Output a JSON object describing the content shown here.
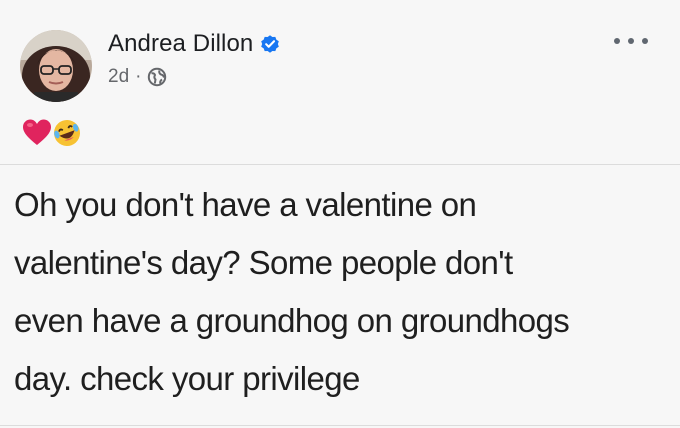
{
  "post": {
    "author_name": "Andrea Dillon",
    "time_ago": "2d",
    "separator": "·",
    "reaction_icons": [
      "heart-icon",
      "laughing-crying-icon"
    ],
    "text_lines": [
      "Oh you don't have a valentine on",
      "valentine's day? Some people don't",
      "even have a groundhog on groundhogs",
      "day. check your privilege"
    ]
  },
  "colors": {
    "verified": "#1877f2",
    "meta": "#65676b",
    "heart": "#e0245e",
    "laugh": "#f7c233"
  }
}
